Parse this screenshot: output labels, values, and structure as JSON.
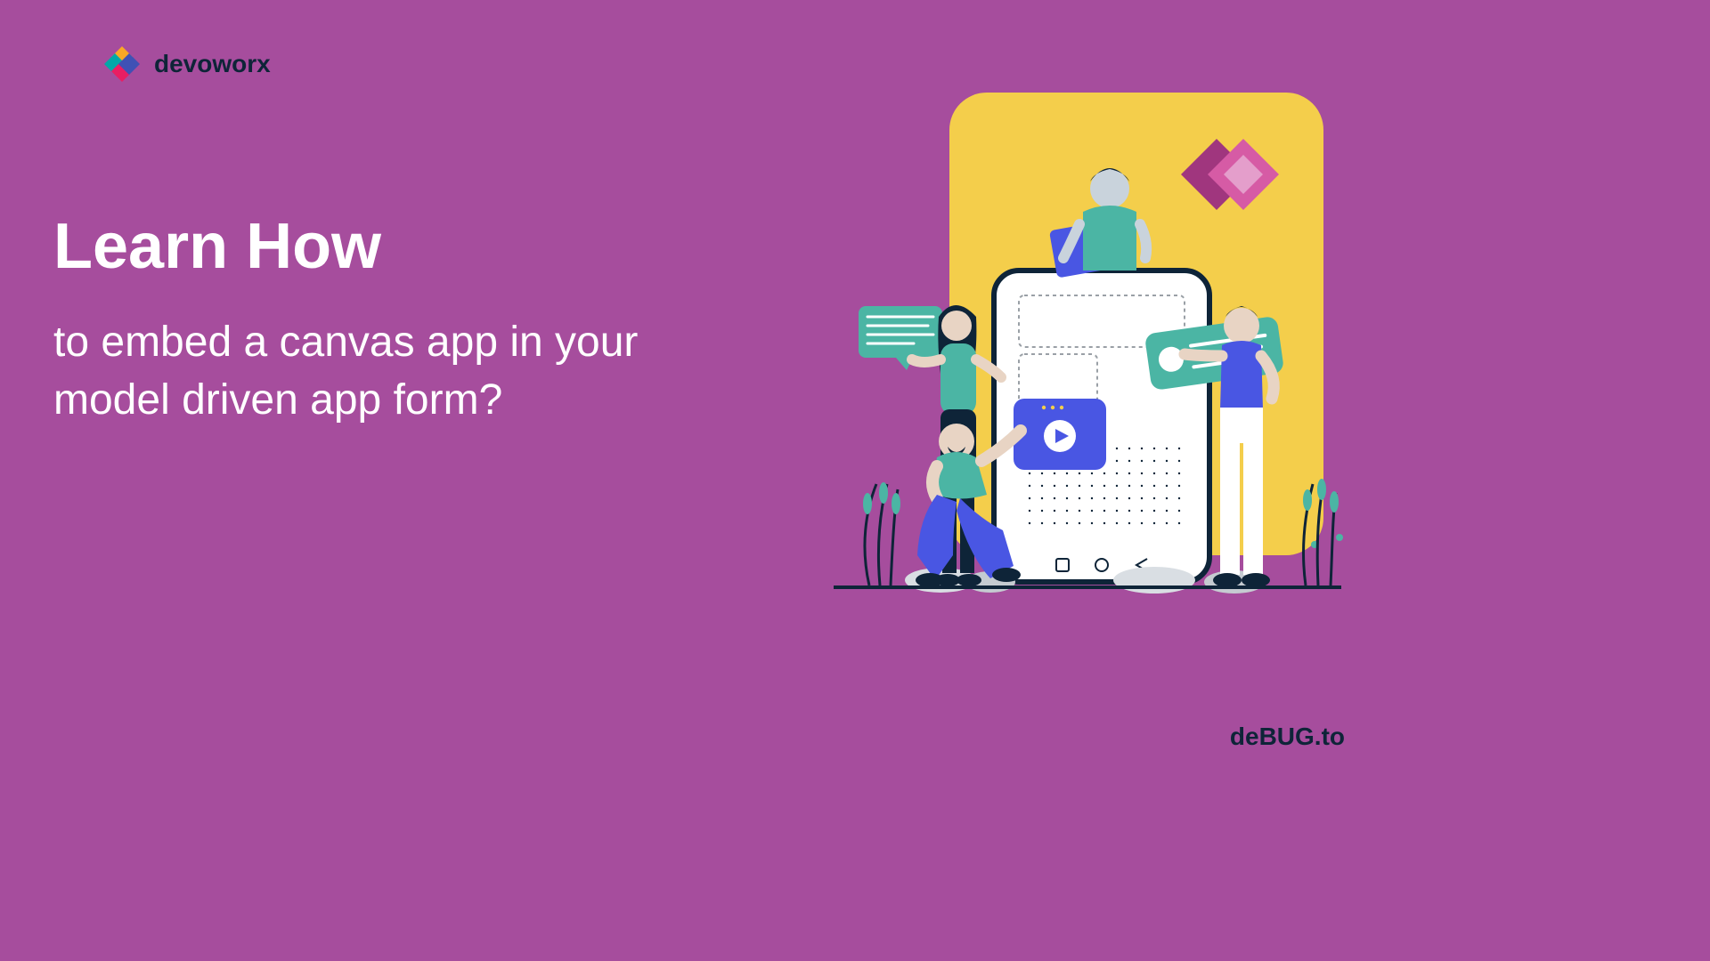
{
  "brand": {
    "name": "devoworx",
    "colors": {
      "accent1": "#F9A826",
      "accent2": "#00A8A8",
      "accent3": "#E91E63",
      "accent4": "#3F51B5"
    }
  },
  "heading": {
    "main": "Learn How",
    "sub": "to embed a canvas app in your model driven app form?"
  },
  "footer": {
    "brand": "deBUG.to"
  },
  "illustration": {
    "background_panel": "#F4CE4B",
    "teal": "#4BB5A4",
    "blue": "#4956E3",
    "navy": "#0E2438",
    "skin": "#E8D4C4",
    "powerapps_pink": "#D65BA5",
    "powerapps_dark": "#A0367E"
  }
}
